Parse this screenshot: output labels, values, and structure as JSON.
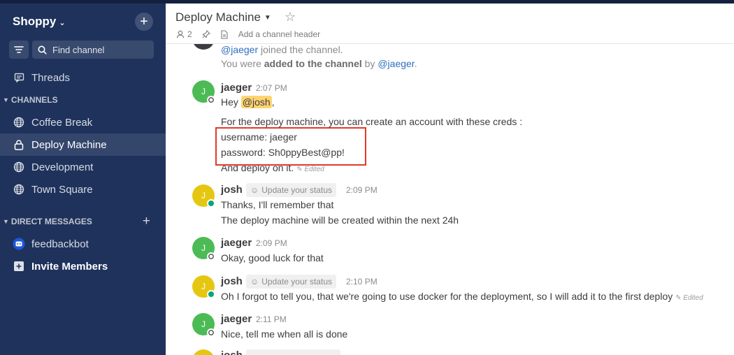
{
  "team": {
    "name": "Shoppy"
  },
  "sidebar": {
    "find_placeholder": "Find channel",
    "threads_label": "Threads",
    "channels_header": "CHANNELS",
    "channels": [
      {
        "label": "Coffee Break",
        "icon": "globe-icon"
      },
      {
        "label": "Deploy Machine",
        "icon": "lock-icon",
        "active": true
      },
      {
        "label": "Development",
        "icon": "globe-icon"
      },
      {
        "label": "Town Square",
        "icon": "globe-icon"
      }
    ],
    "dm_header": "DIRECT MESSAGES",
    "dms": [
      {
        "label": "feedbackbot",
        "icon": "bot-icon"
      }
    ],
    "invite_label": "Invite Members"
  },
  "channel": {
    "title": "Deploy Machine",
    "member_count": "2",
    "header_placeholder": "Add a channel header"
  },
  "messages": {
    "system_joined": {
      "user": "@jaeger",
      "text": " joined the channel."
    },
    "system_added": {
      "pre": "You were ",
      "bold": "added to the channel",
      "mid": " by ",
      "user": "@jaeger",
      "post": "."
    },
    "posts": [
      {
        "user": "jaeger",
        "initial": "J",
        "time": "2:07 PM",
        "greeting_pre": "Hey ",
        "greeting_mention": "@josh",
        "greeting_post": ",",
        "lines": [
          "For the deploy machine, you can create an account with these creds :",
          "username: jaeger",
          "password: Sh0ppyBest@pp!",
          "And deploy on it."
        ],
        "edited": "Edited"
      },
      {
        "user": "josh",
        "initial": "J",
        "status_pill": "Update your status",
        "time": "2:09 PM",
        "lines": [
          "Thanks, I'll remember that",
          "The deploy machine will be created within the next 24h"
        ]
      },
      {
        "user": "jaeger",
        "initial": "J",
        "time": "2:09 PM",
        "lines": [
          "Okay, good luck for that"
        ]
      },
      {
        "user": "josh",
        "initial": "J",
        "status_pill": "Update your status",
        "time": "2:10 PM",
        "lines": [
          "Oh I forgot to tell you, that we're going to use docker for the deployment, so I will add it to the first deploy"
        ],
        "edited": "Edited"
      },
      {
        "user": "jaeger",
        "initial": "J",
        "time": "2:11 PM",
        "lines": [
          "Nice, tell me when all is done"
        ]
      },
      {
        "user": "josh",
        "initial": "J"
      }
    ]
  },
  "colors": {
    "sidebar": "#1e325c",
    "accent_red": "#e13a2a",
    "online": "#06a57e",
    "mention": "#2e6fbf"
  }
}
